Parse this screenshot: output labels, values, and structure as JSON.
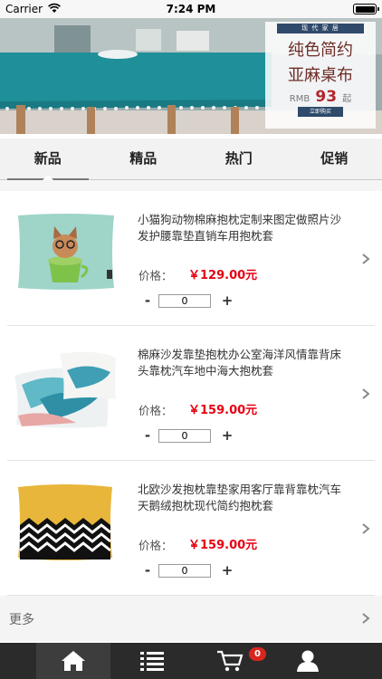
{
  "status_bar": {
    "carrier": "Carrier",
    "time": "7:24 PM"
  },
  "banner": {
    "tag": "现 代 家 居",
    "line1": "纯色简约",
    "line2": "亚麻桌布",
    "currency": "RMB",
    "price": "93",
    "suffix": "起",
    "button": "立即购买"
  },
  "tabs": [
    {
      "label": "新品",
      "active": true
    },
    {
      "label": "精品",
      "active": false
    },
    {
      "label": "热门",
      "active": false
    },
    {
      "label": "促销",
      "active": false
    }
  ],
  "products": [
    {
      "title": "小猫狗动物棉麻抱枕定制来图定做照片沙发护腰靠垫直销车用抱枕套",
      "price_label": "价格：",
      "price": "￥129.00元",
      "qty": "0",
      "minus": "-",
      "plus": "+",
      "image_icon": "cat-pillow-image"
    },
    {
      "title": "棉麻沙发靠垫抱枕办公室海洋风情靠背床头靠枕汽车地中海大抱枕套",
      "price_label": "价格：",
      "price": "￥159.00元",
      "qty": "0",
      "minus": "-",
      "plus": "+",
      "image_icon": "ocean-pillow-image"
    },
    {
      "title": "北欧沙发抱枕靠垫家用客厅靠背靠枕汽车天鹅绒抱枕现代简约抱枕套",
      "price_label": "价格：",
      "price": "￥159.00元",
      "qty": "0",
      "minus": "-",
      "plus": "+",
      "image_icon": "zigzag-pillow-image"
    }
  ],
  "more": {
    "label": "更多"
  },
  "tabbar": {
    "items": [
      {
        "icon": "home-icon",
        "active": true
      },
      {
        "icon": "list-icon",
        "active": false
      },
      {
        "icon": "cart-icon",
        "active": false
      },
      {
        "icon": "user-icon",
        "active": false
      }
    ],
    "cart_badge": "0"
  },
  "colors": {
    "price": "#e60012",
    "tabbar_bg": "#2b2b2b",
    "badge": "#d7261e"
  }
}
